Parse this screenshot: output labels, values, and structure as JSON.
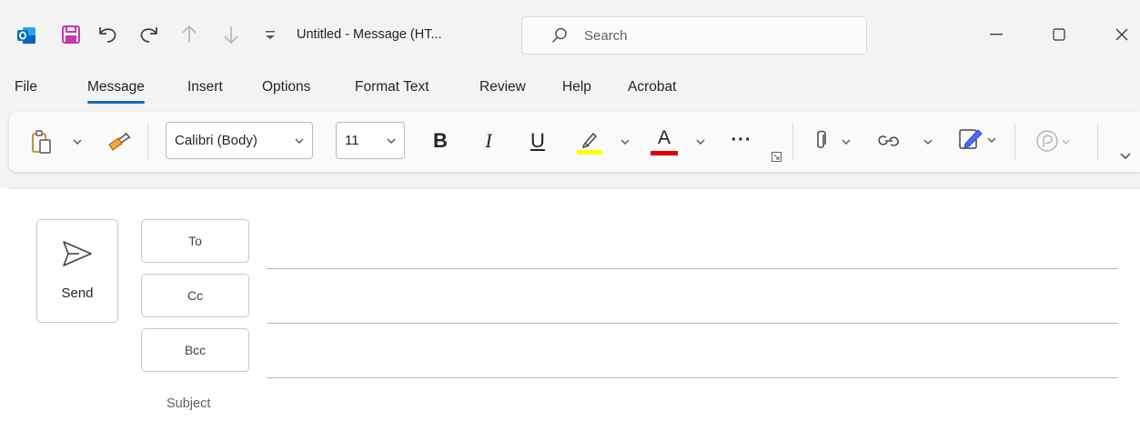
{
  "titlebar": {
    "title": "Untitled  -  Message (HT...",
    "search_placeholder": "Search",
    "icons": [
      "outlook-app-icon",
      "save-icon",
      "undo-icon",
      "redo-icon",
      "previous-item-icon",
      "next-item-icon",
      "customize-quick-access-icon"
    ]
  },
  "tabs": [
    {
      "label": "File"
    },
    {
      "label": "Message",
      "active": true
    },
    {
      "label": "Insert"
    },
    {
      "label": "Options"
    },
    {
      "label": "Format Text"
    },
    {
      "label": "Review"
    },
    {
      "label": "Help"
    },
    {
      "label": "Acrobat"
    }
  ],
  "ribbon": {
    "font_name": "Calibri (Body)",
    "font_size": "11",
    "bold_label": "B",
    "italic_label": "I",
    "underline_label": "U",
    "font_color_label": "A",
    "more_label": "···",
    "highlight_color": "#ffff00",
    "font_color": "#e00000"
  },
  "compose": {
    "send_label": "Send",
    "to_label": "To",
    "cc_label": "Cc",
    "bcc_label": "Bcc",
    "subject_label": "Subject",
    "to_value": "",
    "cc_value": "",
    "bcc_value": "",
    "subject_value": ""
  },
  "colors": {
    "accent": "#0f6cbd",
    "save_icon": "#c239b3",
    "outlook_blue": "#0f6cbd"
  }
}
